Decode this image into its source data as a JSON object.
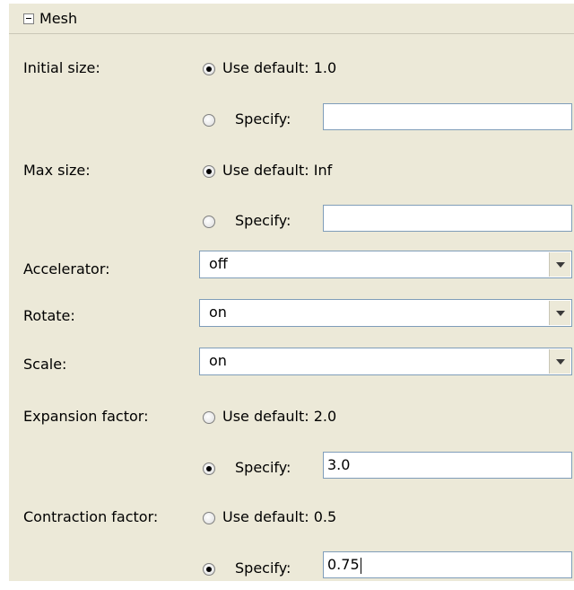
{
  "section": {
    "title": "Mesh",
    "collapsed": false
  },
  "fields": {
    "initial_size": {
      "label": "Initial size:",
      "default_label": "Use default: 1.0",
      "specify_label": "Specify:",
      "selected": "default",
      "specify_value": ""
    },
    "max_size": {
      "label": "Max size:",
      "default_label": "Use default: Inf",
      "specify_label": "Specify:",
      "selected": "default",
      "specify_value": ""
    },
    "accelerator": {
      "label": "Accelerator:",
      "value": "off"
    },
    "rotate": {
      "label": "Rotate:",
      "value": "on"
    },
    "scale": {
      "label": "Scale:",
      "value": "on"
    },
    "expansion_factor": {
      "label": "Expansion factor:",
      "default_label": "Use default: 2.0",
      "specify_label": "Specify:",
      "selected": "specify",
      "specify_value": "3.0"
    },
    "contraction_factor": {
      "label": "Contraction factor:",
      "default_label": "Use default: 0.5",
      "specify_label": "Specify:",
      "selected": "specify",
      "specify_value": "0.75"
    }
  },
  "icons": {
    "collapse": "minus-box-icon",
    "dropdown": "chevron-down-icon",
    "radio": "radio-icon"
  },
  "colors": {
    "panel_bg": "#ece9d8",
    "input_border": "#7f9db9",
    "input_bg": "#ffffff"
  }
}
